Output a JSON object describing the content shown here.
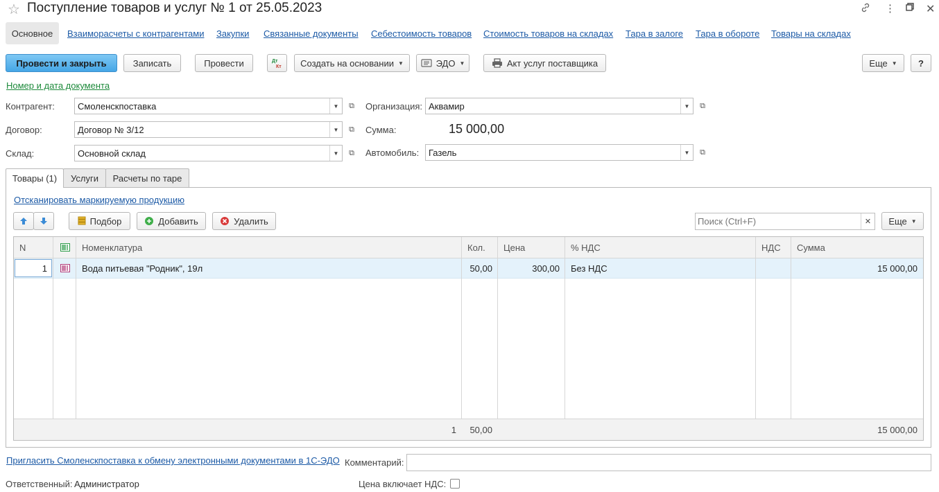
{
  "window": {
    "title": "Поступление товаров и услуг № 1 от 25.05.2023"
  },
  "section_tabs": [
    {
      "label": "Основное",
      "active": true
    },
    {
      "label": "Взаиморасчеты с контрагентами"
    },
    {
      "label": "Закупки"
    },
    {
      "label": "Связанные документы"
    },
    {
      "label": "Себестоимость товаров"
    },
    {
      "label": "Стоимость товаров на складах"
    },
    {
      "label": "Тара в залоге"
    },
    {
      "label": "Тара в обороте"
    },
    {
      "label": "Товары на складах"
    }
  ],
  "toolbar": {
    "post_close": "Провести и закрыть",
    "save": "Записать",
    "post": "Провести",
    "dtkt": "Дт Кт",
    "create_based": "Создать на основании",
    "edo": "ЭДО",
    "act": "Акт услуг поставщика",
    "more": "Еще",
    "help": "?"
  },
  "doc_number_link": "Номер и дата документа",
  "form": {
    "counterparty_label": "Контрагент:",
    "counterparty_value": "Смоленскпоставка",
    "contract_label": "Договор:",
    "contract_value": "Договор № 3/12",
    "warehouse_label": "Склад:",
    "warehouse_value": "Основной склад",
    "org_label": "Организация:",
    "org_value": "Аквамир",
    "sum_label": "Сумма:",
    "sum_value": "15 000,00",
    "car_label": "Автомобиль:",
    "car_value": "Газель"
  },
  "page_tabs": [
    {
      "label": "Товары (1)",
      "active": true
    },
    {
      "label": "Услуги"
    },
    {
      "label": "Расчеты по таре"
    }
  ],
  "goods": {
    "scan_link": "Отсканировать маркируемую продукцию",
    "pick": "Подбор",
    "add": "Добавить",
    "delete": "Удалить",
    "search_placeholder": "Поиск (Ctrl+F)",
    "more": "Еще",
    "columns": {
      "n": "N",
      "nomenclature": "Номенклатура",
      "qty": "Кол.",
      "price": "Цена",
      "vat_rate": "% НДС",
      "vat": "НДС",
      "sum": "Сумма"
    },
    "rows": [
      {
        "n": "1",
        "nomenclature": "Вода питьевая \"Родник\", 19л",
        "qty": "50,00",
        "price": "300,00",
        "vat_rate": "Без НДС",
        "vat": "",
        "sum": "15 000,00"
      }
    ],
    "footer": {
      "n": "1",
      "qty": "50,00",
      "sum": "15 000,00"
    }
  },
  "bottom": {
    "invite_link": "Пригласить Смоленскпоставка к обмену электронными документами в 1С-ЭДО",
    "comment_label": "Комментарий:",
    "comment_value": "",
    "responsible_label": "Ответственный:",
    "responsible_value": "Администратор",
    "vat_included_label": "Цена включает НДС:",
    "vat_included": false
  },
  "colors": {
    "accent": "#45a6e6",
    "link": "#1c5aa6",
    "link_green": "#1d8a3b",
    "selected_row": "#e4f2fb"
  }
}
